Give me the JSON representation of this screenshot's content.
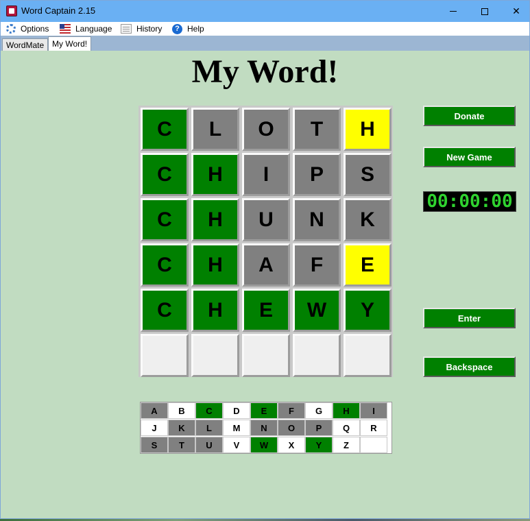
{
  "window": {
    "title": "Word Captain 2.15",
    "controls": {
      "minimize": "minimize",
      "maximize": "maximize",
      "close": "✕"
    }
  },
  "menu": {
    "items": [
      {
        "label": "Options",
        "icon": "gear-icon"
      },
      {
        "label": "Language",
        "icon": "flag-icon"
      },
      {
        "label": "History",
        "icon": "history-icon"
      },
      {
        "label": "Help",
        "icon": "help-icon"
      }
    ],
    "help_glyph": "?"
  },
  "tabs": [
    {
      "label": "WordMate",
      "active": false
    },
    {
      "label": "My Word!",
      "active": true
    }
  ],
  "main": {
    "heading": "My Word!",
    "timer": "00:00:00",
    "buttons": {
      "donate": "Donate",
      "new_game": "New Game",
      "enter": "Enter",
      "backspace": "Backspace"
    }
  },
  "colors": {
    "correct": "#008000",
    "absent": "#808080",
    "present": "#ffff00",
    "empty": "#efefef",
    "background": "#c1dcc1"
  },
  "board": {
    "rows": [
      {
        "letters": [
          "C",
          "L",
          "O",
          "T",
          "H"
        ],
        "states": [
          "correct",
          "absent",
          "absent",
          "absent",
          "present"
        ]
      },
      {
        "letters": [
          "C",
          "H",
          "I",
          "P",
          "S"
        ],
        "states": [
          "correct",
          "correct",
          "absent",
          "absent",
          "absent"
        ]
      },
      {
        "letters": [
          "C",
          "H",
          "U",
          "N",
          "K"
        ],
        "states": [
          "correct",
          "correct",
          "absent",
          "absent",
          "absent"
        ]
      },
      {
        "letters": [
          "C",
          "H",
          "A",
          "F",
          "E"
        ],
        "states": [
          "correct",
          "correct",
          "absent",
          "absent",
          "present"
        ]
      },
      {
        "letters": [
          "C",
          "H",
          "E",
          "W",
          "Y"
        ],
        "states": [
          "correct",
          "correct",
          "correct",
          "correct",
          "correct"
        ]
      },
      {
        "letters": [
          "",
          "",
          "",
          "",
          ""
        ],
        "states": [
          "empty",
          "empty",
          "empty",
          "empty",
          "empty"
        ]
      }
    ]
  },
  "keyboard": {
    "rows": [
      {
        "keys": [
          "A",
          "B",
          "C",
          "D",
          "E",
          "F",
          "G",
          "H",
          "I"
        ],
        "states": [
          "absent",
          "unused",
          "correct",
          "unused",
          "correct",
          "absent",
          "unused",
          "correct",
          "absent"
        ]
      },
      {
        "keys": [
          "J",
          "K",
          "L",
          "M",
          "N",
          "O",
          "P",
          "Q",
          "R"
        ],
        "states": [
          "unused",
          "absent",
          "absent",
          "unused",
          "absent",
          "absent",
          "absent",
          "unused",
          "unused"
        ]
      },
      {
        "keys": [
          "S",
          "T",
          "U",
          "V",
          "W",
          "X",
          "Y",
          "Z",
          ""
        ],
        "states": [
          "absent",
          "absent",
          "absent",
          "unused",
          "correct",
          "unused",
          "correct",
          "unused",
          "unused"
        ]
      }
    ]
  }
}
